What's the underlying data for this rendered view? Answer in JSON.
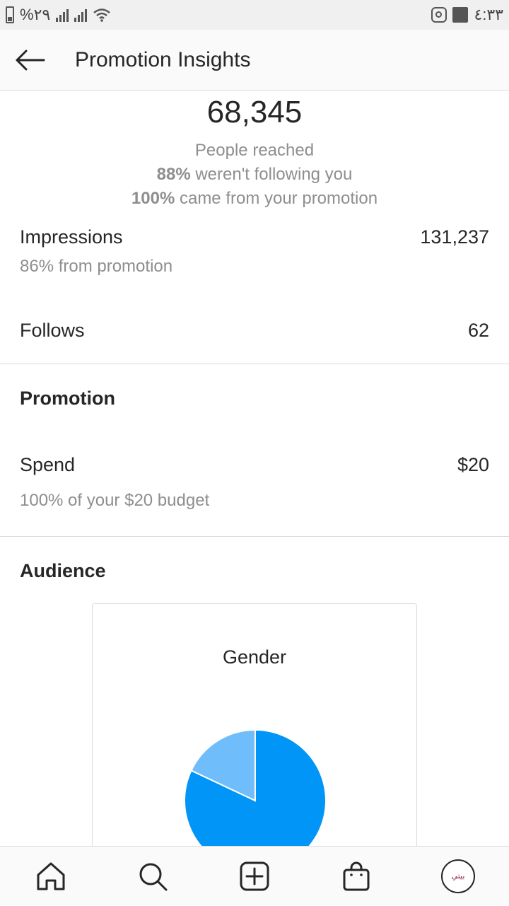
{
  "status_bar": {
    "battery": "%٢٩",
    "time": "٤:٣٣"
  },
  "header": {
    "title": "Promotion Insights"
  },
  "reach": {
    "number": "68,345",
    "label": "People reached",
    "not_following_pct": "88%",
    "not_following_text": " weren't following you",
    "from_promo_pct": "100%",
    "from_promo_text": " came from your promotion"
  },
  "impressions": {
    "label": "Impressions",
    "value": "131,237",
    "sub": "86% from promotion"
  },
  "follows": {
    "label": "Follows",
    "value": "62"
  },
  "promotion": {
    "title": "Promotion",
    "spend_label": "Spend",
    "spend_value": "$20",
    "budget_text": "100% of your $20 budget"
  },
  "audience": {
    "title": "Audience",
    "card_title": "Gender"
  },
  "chart_data": {
    "type": "pie",
    "title": "Gender",
    "values": [
      82,
      18
    ],
    "colors": [
      "#0095f6",
      "#6fbdfa"
    ]
  },
  "avatar": {
    "label": "بيتي"
  },
  "colors": {
    "accent": "#0095f6",
    "accent_light": "#6fbdfa",
    "text_primary": "#262626",
    "text_secondary": "#8e8e8e",
    "divider": "#dbdbdb"
  }
}
